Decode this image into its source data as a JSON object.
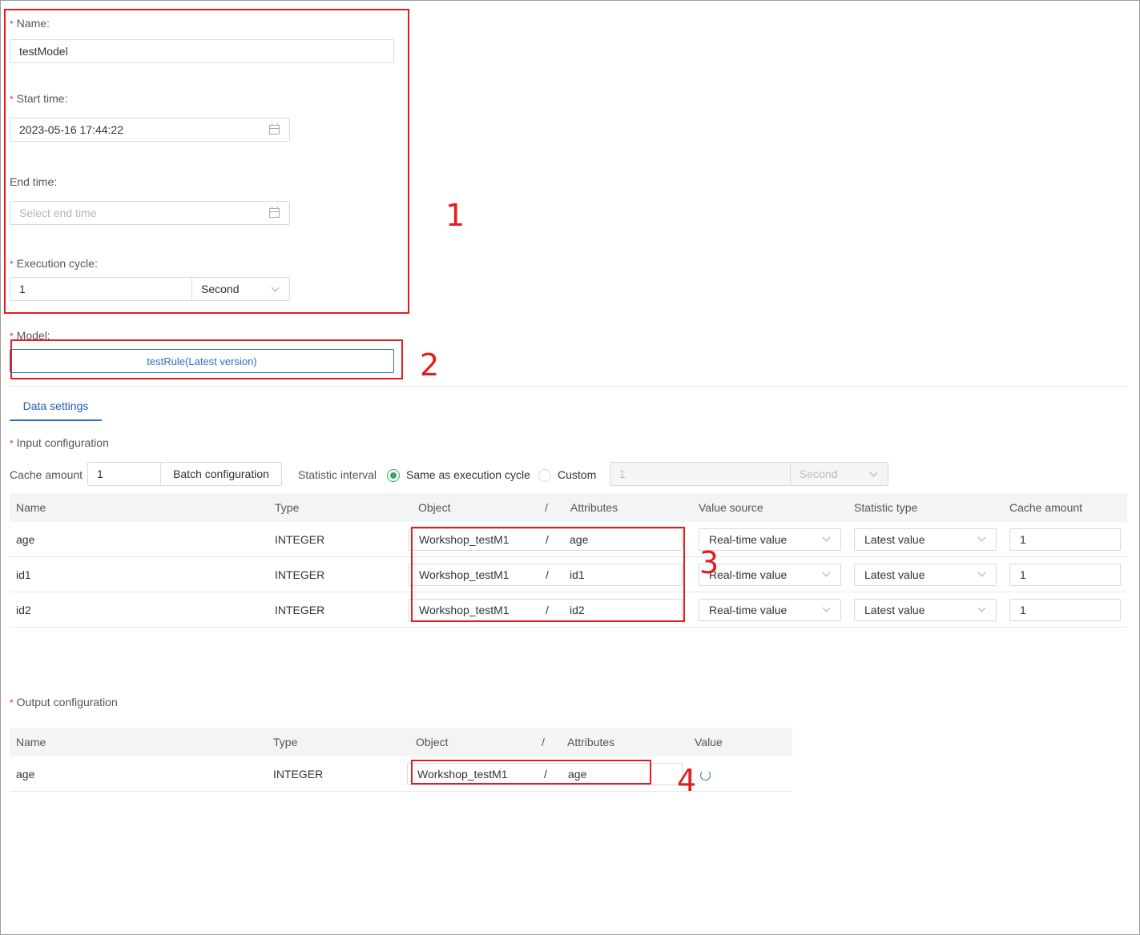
{
  "form": {
    "name_label": "Name:",
    "name_value": "testModel",
    "start_label": "Start time:",
    "start_value": "2023-05-16 17:44:22",
    "end_label": "End time:",
    "end_placeholder": "Select end time",
    "cycle_label": "Execution cycle:",
    "cycle_value": "1",
    "cycle_unit": "Second",
    "model_label": "Model:",
    "model_value": "testRule(Latest version)"
  },
  "tabs": {
    "data_settings": "Data settings"
  },
  "input_config": {
    "title": "Input configuration",
    "cache_label": "Cache amount",
    "cache_value": "1",
    "batch_button": "Batch configuration",
    "interval_label": "Statistic interval",
    "radio_same": "Same as execution cycle",
    "radio_custom": "Custom",
    "custom_value": "1",
    "custom_unit": "Second",
    "columns": [
      "Name",
      "Type",
      "Object",
      "/",
      "Attributes",
      "Value source",
      "Statistic type",
      "Cache amount"
    ],
    "rows": [
      {
        "name": "age",
        "type": "INTEGER",
        "object": "Workshop_testM1",
        "sep": "/",
        "attribute": "age",
        "value_source": "Real-time value",
        "statistic_type": "Latest value",
        "cache": "1"
      },
      {
        "name": "id1",
        "type": "INTEGER",
        "object": "Workshop_testM1",
        "sep": "/",
        "attribute": "id1",
        "value_source": "Real-time value",
        "statistic_type": "Latest value",
        "cache": "1"
      },
      {
        "name": "id2",
        "type": "INTEGER",
        "object": "Workshop_testM1",
        "sep": "/",
        "attribute": "id2",
        "value_source": "Real-time value",
        "statistic_type": "Latest value",
        "cache": "1"
      }
    ]
  },
  "output_config": {
    "title": "Output configuration",
    "columns": [
      "Name",
      "Type",
      "Object",
      "/",
      "Attributes",
      "Value"
    ],
    "rows": [
      {
        "name": "age",
        "type": "INTEGER",
        "object": "Workshop_testM1",
        "sep": "/",
        "attribute": "age"
      }
    ]
  },
  "annotations": {
    "n1": "1",
    "n2": "2",
    "n3": "3",
    "n4": "4"
  },
  "colors": {
    "accent": "#2f6fc0",
    "annotation_red": "#e01e1e",
    "required": "#e0302f",
    "radio_on": "#3aa56a"
  },
  "icons": [
    "calendar-icon",
    "chevron-down-icon",
    "refresh-icon"
  ]
}
